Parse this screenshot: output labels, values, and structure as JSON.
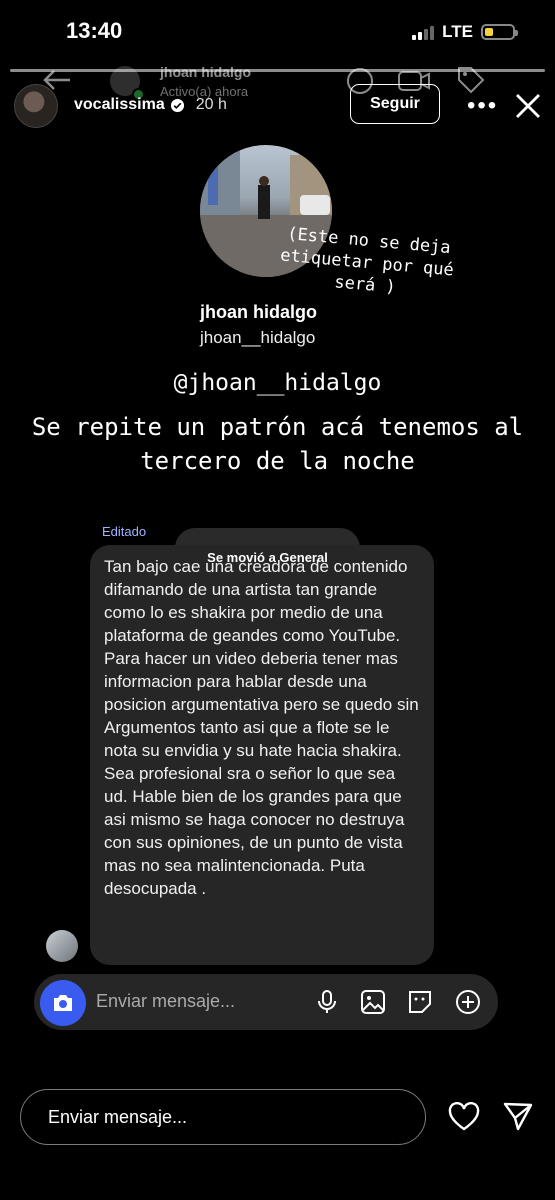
{
  "status_bar": {
    "time": "13:40",
    "network": "LTE"
  },
  "ghost_header": {
    "name": "jhoan hidalgo",
    "status": "Activo(a) ahora"
  },
  "story_header": {
    "username": "vocalissima",
    "time_ago": "20 h",
    "follow_label": "Seguir"
  },
  "tagged": {
    "overlay_text": "(Este no se deja etiquetar por qué será )",
    "name": "jhoan hidalgo",
    "handle": "jhoan__hidalgo"
  },
  "mention": "@jhoan__hidalgo",
  "caption": "Se repite un patrón acá tenemos al tercero de la noche",
  "dm": {
    "edited_label": "Editado",
    "moved_label": "Se movió a General",
    "message": "Tan bajo cae una creadora de contenido difamando de una artista tan grande como lo es  shakira por medio de  una plataforma de geandes como YouTube. Para hacer un video deberia tener mas informacion para hablar desde una posicion argumentativa pero se quedo sin Argumentos tanto asi que a flote se le nota su envidia y su hate hacia shakira. Sea profesional sra o señor lo que sea ud. Hable bien de los grandes para que asi mismo se haga conocer no destruya con sus opiniones, de un punto de vista mas no sea malintencionada. Puta desocupada .",
    "composer_placeholder": "Enviar mensaje..."
  },
  "reply": {
    "placeholder": "Enviar mensaje..."
  },
  "battery_level": 0.2,
  "colors": {
    "accent_blue": "#3a5bf0",
    "bubble": "#262626",
    "online": "#2ec24a",
    "battery": "#f5d33a"
  }
}
